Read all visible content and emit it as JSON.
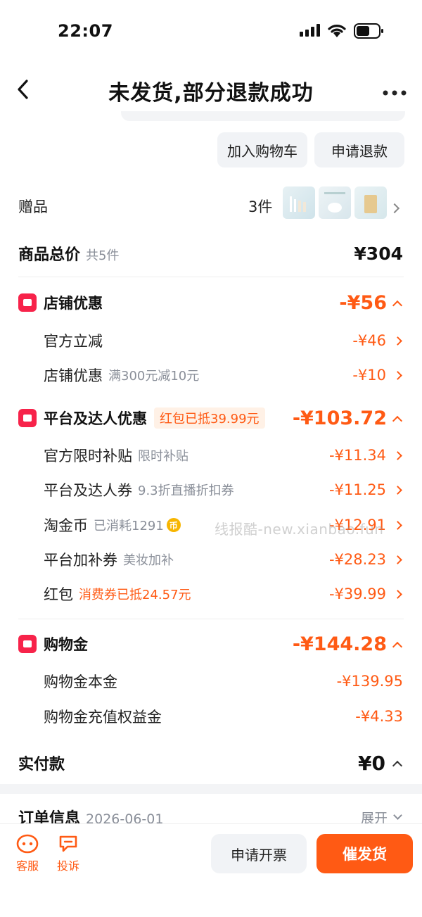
{
  "status_bar": {
    "time": "22:07"
  },
  "header": {
    "title": "未发货,部分退款成功"
  },
  "actions": {
    "add_cart": "加入购物车",
    "refund": "申请退款"
  },
  "gift": {
    "label": "赠品",
    "count": "3件"
  },
  "total": {
    "label": "商品总价",
    "sub": "共5件",
    "amount": "¥304"
  },
  "shop_discount": {
    "title": "店铺优惠",
    "amount": "-¥56",
    "items": [
      {
        "label": "官方立减",
        "sub": "",
        "amount": "-¥46"
      },
      {
        "label": "店铺优惠",
        "sub": "满300元减10元",
        "amount": "-¥10"
      }
    ]
  },
  "platform_discount": {
    "title": "平台及达人优惠",
    "tag": "红包已抵39.99元",
    "amount": "-¥103.72",
    "items": [
      {
        "label": "官方限时补贴",
        "sub": "限时补贴",
        "amount": "-¥11.34"
      },
      {
        "label": "平台及达人券",
        "sub": "9.3折直播折扣券",
        "amount": "-¥11.25"
      },
      {
        "label": "淘金币",
        "sub": "已消耗1291",
        "amount": "-¥12.91"
      },
      {
        "label": "平台加补券",
        "sub": "美妆加补",
        "amount": "-¥28.23"
      },
      {
        "label": "红包",
        "sub": "消费券已抵24.57元",
        "amount": "-¥39.99"
      }
    ]
  },
  "shopping_money": {
    "title": "购物金",
    "amount": "-¥144.28",
    "items": [
      {
        "label": "购物金本金",
        "amount": "-¥139.95"
      },
      {
        "label": "购物金充值权益金",
        "amount": "-¥4.33"
      }
    ]
  },
  "paid": {
    "label": "实付款",
    "amount": "¥0"
  },
  "order_info": {
    "label": "订单信息",
    "date": "2026-06-01",
    "expand": "展开"
  },
  "watermark": "线报酷-new.xianbao.fun",
  "bottom_bar": {
    "service": "客服",
    "complain": "投诉",
    "invoice": "申请开票",
    "urge": "催发货"
  },
  "colors": {
    "accent": "#ff5a14",
    "badge": "#f7234a"
  }
}
